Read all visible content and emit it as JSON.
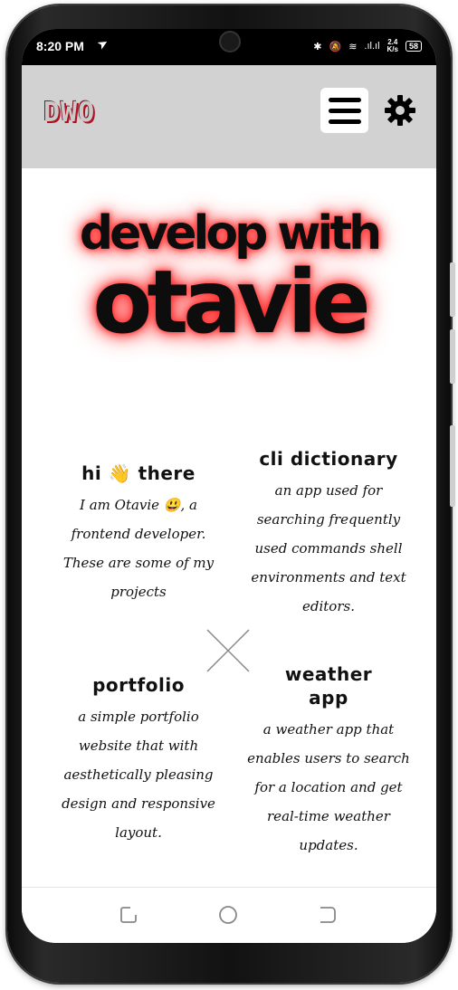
{
  "status": {
    "time": "8:20 PM",
    "send_icon": "telegram-icon",
    "speed_value": "2.4",
    "speed_unit": "K/s",
    "battery": "58"
  },
  "header": {
    "logo_text": "DWO",
    "menu_icon": "hamburger-icon",
    "settings_icon": "gear-icon",
    "colors": {
      "background": "#d2d2d2",
      "accent": "#b01020"
    }
  },
  "hero": {
    "line1": "develop with",
    "line2": "otavie",
    "glow_color": "#ff2020"
  },
  "cards": {
    "intro": {
      "title_before": "hi",
      "title_emoji": "👋",
      "title_after": "there",
      "text_line1": "I am Otavie 😃, a",
      "text_line2": "frontend developer.",
      "text_line3": "These are some of my",
      "text_line4": "projects"
    },
    "cli": {
      "title": "cli dictionary",
      "text_line1": "an app used for",
      "text_line2": "searching frequently",
      "text_line3": "used commands shell",
      "text_line4": "environments and text",
      "text_line5": "editors."
    },
    "portfolio": {
      "title": "portfolio",
      "text_line1": "a simple portfolio",
      "text_line2": "website that with",
      "text_line3": "aesthetically pleasing",
      "text_line4": "design and responsive",
      "text_line5": "layout."
    },
    "weather": {
      "title_line1": "weather",
      "title_line2": "app",
      "text_line1": "a weather app that",
      "text_line2": "enables users to search",
      "text_line3": "for a location and get",
      "text_line4": "real-time weather",
      "text_line5": "updates."
    }
  },
  "nav": {
    "recent_icon": "recent-apps-icon",
    "home_icon": "home-circle-icon",
    "back_icon": "back-icon"
  }
}
